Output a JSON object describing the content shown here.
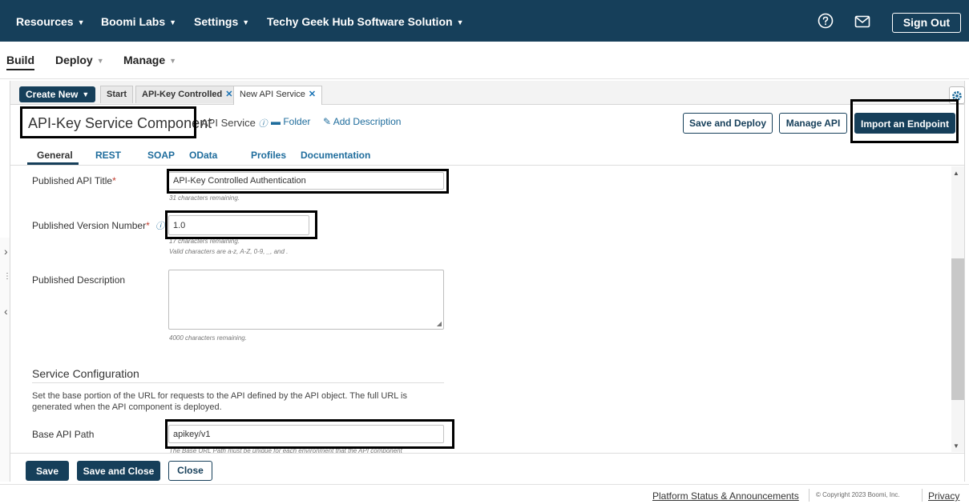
{
  "top_nav": {
    "items": [
      {
        "label": "Resources"
      },
      {
        "label": "Boomi Labs"
      },
      {
        "label": "Settings"
      },
      {
        "label": "Techy Geek Hub Software Solution"
      }
    ],
    "help_icon": "help-circle-icon",
    "messages_icon": "envelope-icon",
    "sign_out_label": "Sign Out"
  },
  "sub_nav": {
    "build": "Build",
    "deploy": "Deploy",
    "manage": "Manage"
  },
  "tabs": {
    "create_new": "Create New",
    "items": [
      {
        "label": "Start"
      },
      {
        "label": "API-Key Controlled"
      },
      {
        "label": "New API Service"
      }
    ],
    "close_glyph": "✕"
  },
  "component": {
    "title": "API-Key Service Component",
    "type": "API Service",
    "folder": "Folder",
    "add_description": "Add Description",
    "save_and_deploy": "Save and Deploy",
    "manage_api": "Manage API",
    "import_endpoint": "Import an Endpoint"
  },
  "subtabs": [
    "General",
    "REST",
    "SOAP",
    "OData",
    "Profiles",
    "Documentation"
  ],
  "form": {
    "published_title_label": "Published API Title",
    "published_title_value": "API-Key Controlled Authentication",
    "published_title_hint": "31 characters remaining.",
    "version_label": "Published Version Number",
    "version_value": "1.0",
    "version_hint_1": "17 characters remaining.",
    "version_hint_2": "Valid characters are a-z, A-Z, 0-9, _, and .",
    "description_label": "Published Description",
    "description_hint": "4000 characters remaining.",
    "service_config_title": "Service Configuration",
    "service_config_text": "Set the base portion of the URL for requests to the API defined by the API object. The full URL is generated when the API component is deployed.",
    "base_path_label": "Base API Path",
    "base_path_value": "apikey/v1",
    "base_path_hint": "The Base URL Path must be unique for each environment that the API component"
  },
  "actions": {
    "save": "Save",
    "save_and_close": "Save and Close",
    "close": "Close"
  },
  "footer": {
    "status": "Platform Status & Announcements",
    "copyright": "© Copyright 2023 Boomi, Inc.",
    "privacy": "Privacy"
  },
  "colors": {
    "brand_navy": "#163f5a",
    "link_blue": "#1e6c9c",
    "required_red": "#c0392b"
  }
}
